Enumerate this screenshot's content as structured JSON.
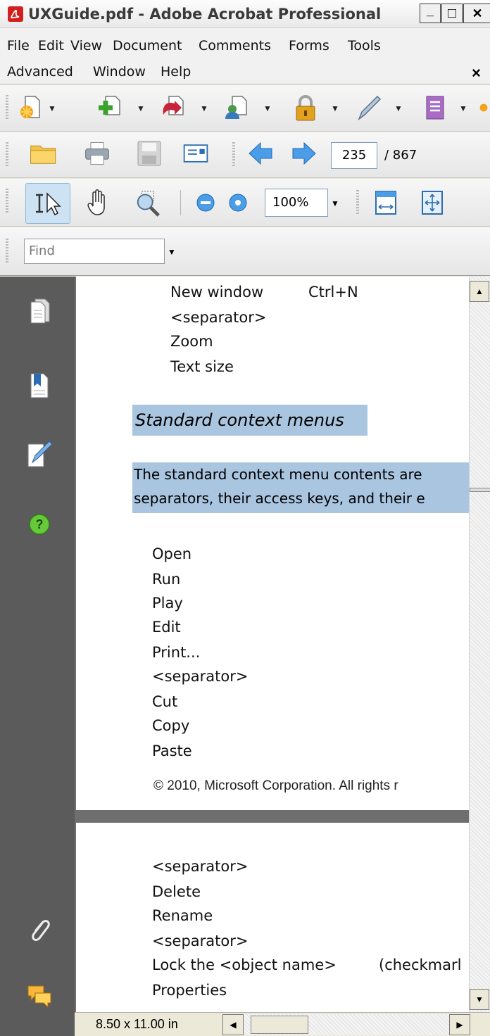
{
  "window": {
    "title": "UXGuide.pdf - Adobe Acrobat Professional",
    "min_glyph": "_",
    "max_glyph": "□",
    "close_glyph": "✕"
  },
  "menu": {
    "row1": [
      "File",
      "Edit",
      "View",
      "Document",
      "Comments",
      "Forms",
      "Tools"
    ],
    "row2": [
      "Advanced",
      "Window",
      "Help"
    ],
    "close": "×"
  },
  "navigation": {
    "current_page": "235",
    "total_pages": "/ 867"
  },
  "zoom": {
    "value": "100%"
  },
  "find": {
    "placeholder": "Find"
  },
  "page1": {
    "lines_top": [
      "New window",
      "<separator>",
      "Zoom",
      "Text size"
    ],
    "shortcut": "Ctrl+N",
    "heading": "Standard context menus",
    "paragraph_line1": "The standard context menu contents are",
    "paragraph_line2": "separators, their access keys, and their e",
    "items": [
      "Open",
      "Run",
      "Play",
      "Edit",
      "Print...",
      "<separator>",
      "Cut",
      "Copy",
      "Paste"
    ],
    "copyright": "© 2010, Microsoft Corporation. All rights r"
  },
  "page2": {
    "items": [
      "<separator>",
      "Delete",
      "Rename",
      "<separator>",
      "Lock the <object name>",
      "Properties"
    ],
    "checkmark": "(checkmarl"
  },
  "status": {
    "page_size": "8.50 x 11.00 in"
  },
  "colors": {
    "highlight": "#a9c5e0",
    "nav_panel": "#5b5b5b",
    "doc_bg": "#6e6e6e"
  }
}
